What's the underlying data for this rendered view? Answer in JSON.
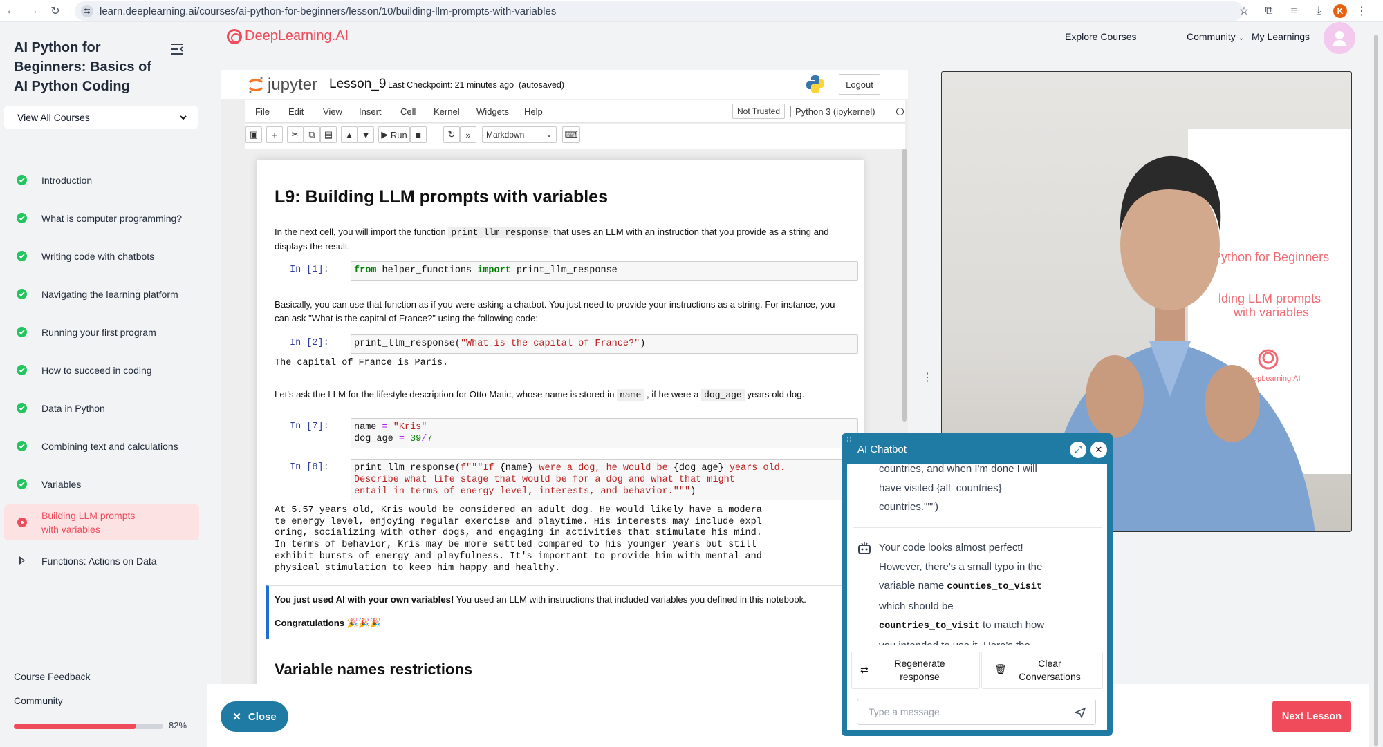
{
  "browser": {
    "url": "learn.deeplearning.ai/courses/ai-python-for-beginners/lesson/10/building-llm-prompts-with-variables",
    "profile_initial": "K"
  },
  "sidebar": {
    "course_title": "AI Python for Beginners: Basics of AI Python Coding",
    "view_all": "View All Courses",
    "lessons": [
      {
        "label": "Introduction",
        "status": "done"
      },
      {
        "label": "What is computer programming?",
        "status": "done"
      },
      {
        "label": "Writing code with chatbots",
        "status": "done"
      },
      {
        "label": "Navigating the learning platform",
        "status": "done"
      },
      {
        "label": "Running your first program",
        "status": "done"
      },
      {
        "label": "How to succeed in coding",
        "status": "done"
      },
      {
        "label": "Data in Python",
        "status": "done"
      },
      {
        "label": "Combining text and calculations",
        "status": "done"
      },
      {
        "label": "Variables",
        "status": "done"
      },
      {
        "label": "Building LLM prompts with variables",
        "status": "current"
      },
      {
        "label": "Functions: Actions on Data",
        "status": "locked"
      }
    ],
    "course_feedback": "Course Feedback",
    "community": "Community",
    "progress_percent": 82,
    "progress_label": "82%"
  },
  "site": {
    "logo_text": "DeepLearning.AI",
    "nav": {
      "explore": "Explore Courses",
      "community": "Community",
      "my_learnings": "My Learnings"
    }
  },
  "jupyter": {
    "brand": "jupyter",
    "notebook_name": "Lesson_9",
    "checkpoint": "Last Checkpoint: 21 minutes ago",
    "autosaved": "(autosaved)",
    "logout": "Logout",
    "menu": [
      "File",
      "Edit",
      "View",
      "Insert",
      "Cell",
      "Kernel",
      "Widgets",
      "Help"
    ],
    "not_trusted": "Not Trusted",
    "kernel": "Python 3 (ipykernel)",
    "run_label": "Run",
    "cell_type": "Markdown"
  },
  "notebook": {
    "title": "L9: Building LLM prompts with variables",
    "md1_a": "In the next cell, you will import the function ",
    "md1_code": "print_llm_response",
    "md1_b": " that uses an LLM with an instruction that you provide as a string and displays the result.",
    "in1": "In [1]:",
    "md2": "Basically, you can use that function as if you were asking a chatbot. You just need to provide your instructions as a string. For instance, you can ask \"What is the capital of France?\" using the following code:",
    "in2": "In [2]:",
    "out2": "The capital of France is Paris.",
    "md3_a": "Let's ask the LLM for the lifestyle description for Otto Matic, whose name is stored in ",
    "md3_code1": "name",
    "md3_b": " , if he were a ",
    "md3_code2": "dog_age",
    "md3_c": " years old dog.",
    "in7": "In [7]:",
    "in8": "In [8]:",
    "out8": "At 5.57 years old, Kris would be considered an adult dog. He would likely have a modera\nte energy level, enjoying regular exercise and playtime. His interests may include expl\noring, socializing with other dogs, and engaging in activities that stimulate his mind.\nIn terms of behavior, Kris may be more settled compared to his younger years but still\nexhibit bursts of energy and playfulness. It's important to provide him with mental and\nphysical stimulation to keep him happy and healthy.",
    "callout_bold": "You just used AI with your own variables!",
    "callout_rest": " You used an LLM with instructions that included variables you defined in this notebook.",
    "congrats": "Congratulations",
    "congrats_emoji": "🎉🎉🎉",
    "h2": "Variable names restrictions"
  },
  "video": {
    "banner_title": "AI Python for Beginners",
    "banner_sub1": "lding LLM prompts",
    "banner_sub2": "with variables",
    "banner_logo": "DeepLearning.AI"
  },
  "chatbot": {
    "title": "AI Chatbot",
    "prev_1": "countries, and when I'm done I will",
    "prev_2": "have visited {all_countries}",
    "prev_3": "countries.\"\"\")",
    "msg_1": "Your code looks almost perfect!",
    "msg_2": "However, there's a small typo in the",
    "msg_3a": "variable name ",
    "msg_3code": "counties_to_visit",
    "msg_4": "which should be",
    "msg_5code": "countries_to_visit",
    "msg_5b": "  to match how",
    "msg_6": "you intended to use it. Here's the",
    "regen_1": "Regenerate",
    "regen_2": "response",
    "clear_1": "Clear",
    "clear_2": "Conversations",
    "placeholder": "Type a message"
  },
  "footer": {
    "close": "Close",
    "next": "Next Lesson"
  },
  "colors": {
    "accent": "#ef4b5a",
    "chat_blue": "#1f7ba3",
    "done_green": "#22c55e"
  }
}
